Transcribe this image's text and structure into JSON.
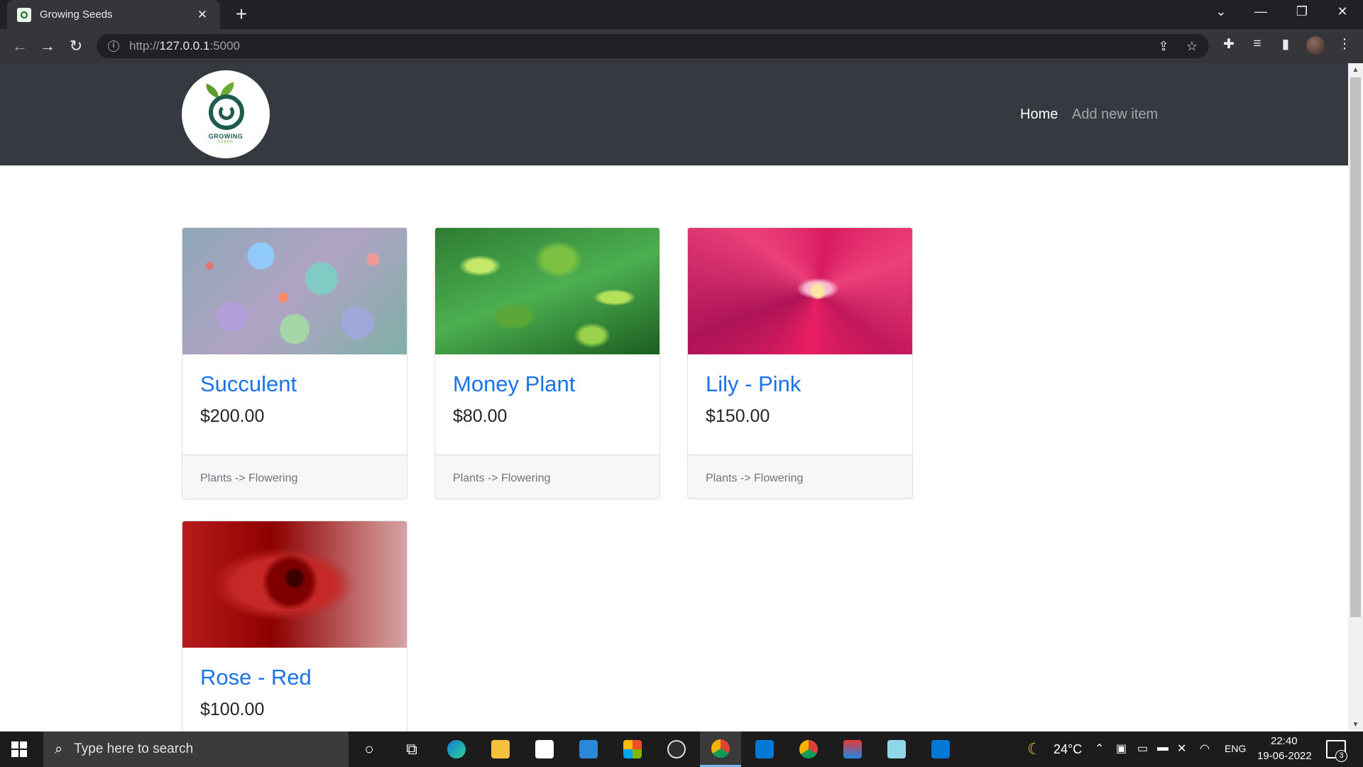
{
  "browser": {
    "tab_title": "Growing Seeds",
    "url_scheme": "http://",
    "url_host": "127.0.0.1",
    "url_port": ":5000"
  },
  "site": {
    "logo_text": "GROWING",
    "logo_sub": "SEEDS",
    "nav": {
      "home": "Home",
      "add_new_item": "Add new item"
    }
  },
  "products": [
    {
      "title": "Succulent",
      "price": "$200.00",
      "category": "Plants -> Flowering"
    },
    {
      "title": "Money Plant",
      "price": "$80.00",
      "category": "Plants -> Flowering"
    },
    {
      "title": "Lily - Pink",
      "price": "$150.00",
      "category": "Plants -> Flowering"
    },
    {
      "title": "Rose - Red",
      "price": "$100.00",
      "category": ""
    }
  ],
  "taskbar": {
    "search_placeholder": "Type here to search",
    "weather": "24°C",
    "language": "ENG",
    "time": "22:40",
    "date": "19-06-2022",
    "notification_count": "3"
  },
  "colors": {
    "navbar": "#343a40",
    "link": "#1a73e8",
    "brand_green": "#1d5c4f"
  }
}
